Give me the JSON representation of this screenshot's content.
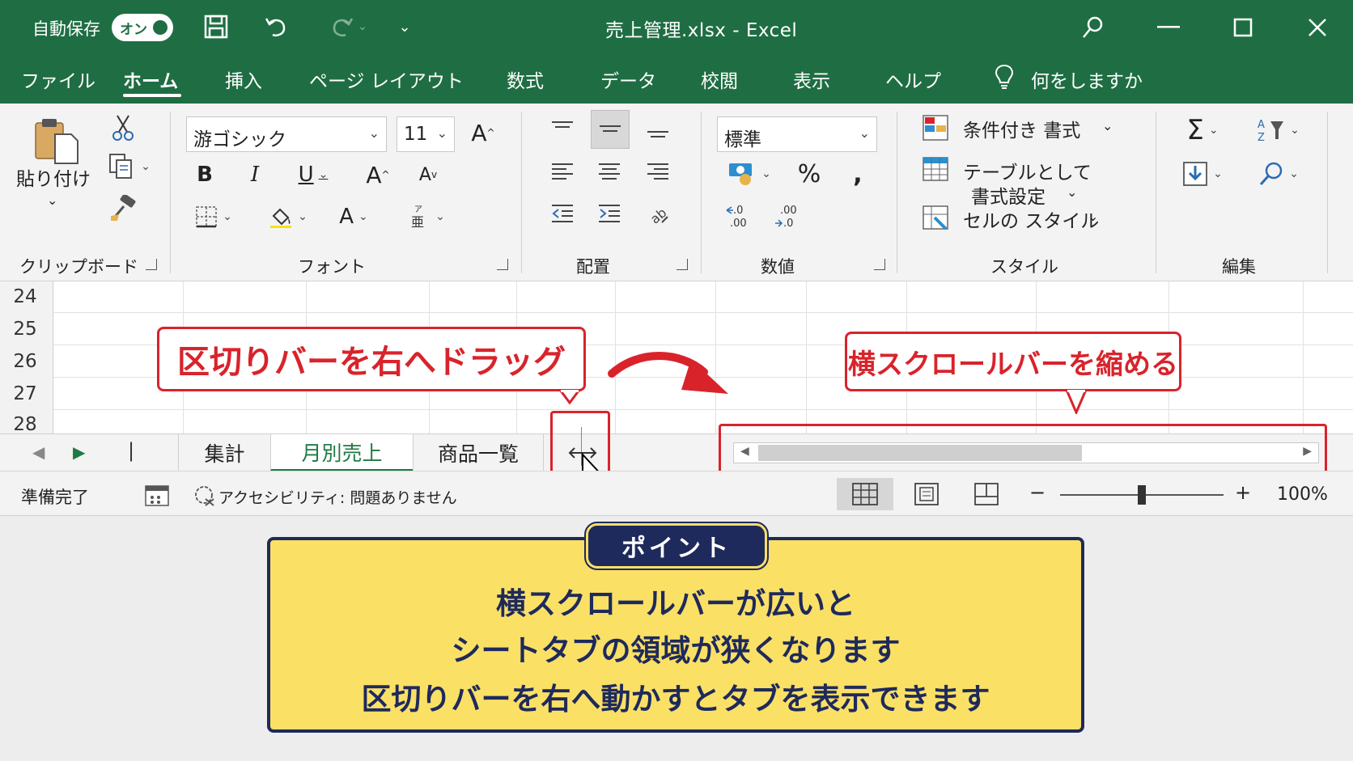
{
  "titlebar": {
    "autosave_label": "自動保存",
    "autosave_toggle": "オン",
    "title": "売上管理.xlsx  -  Excel"
  },
  "menu": {
    "items": [
      "ファイル",
      "ホーム",
      "挿入",
      "ページ レイアウト",
      "数式",
      "データ",
      "校閲",
      "表示",
      "ヘルプ"
    ],
    "active": "ホーム",
    "tell_me": "何をしますか"
  },
  "ribbon": {
    "clipboard": {
      "paste_label": "貼り付け",
      "group_label": "クリップボード"
    },
    "font": {
      "font_name": "游ゴシック",
      "font_size": "11",
      "group_label": "フォント"
    },
    "alignment": {
      "group_label": "配置"
    },
    "number": {
      "format": "標準",
      "group_label": "数値"
    },
    "styles": {
      "conditional": "条件付き 書式",
      "table_line1": "テーブルとして",
      "table_line2": "書式設定",
      "cell_styles": "セルの スタイル",
      "group_label": "スタイル"
    },
    "editing": {
      "group_label": "編集"
    }
  },
  "grid": {
    "row_numbers": [
      "24",
      "25",
      "26",
      "27",
      "28"
    ]
  },
  "callouts": {
    "drag": "区切りバーを右へドラッグ",
    "shrink": "横スクロールバーを縮める"
  },
  "sheet_tabs": {
    "tabs": [
      "集計",
      "月別売上",
      "商品一覧"
    ],
    "active": "月別売上"
  },
  "status": {
    "ready": "準備完了",
    "accessibility": "アクセシビリティ: 問題ありません",
    "zoom": "100%",
    "zoom_minus": "−",
    "zoom_plus": "+",
    "zoom_level": 0.5
  },
  "point": {
    "badge": "ポイント",
    "lines": [
      "横スクロールバーが広いと",
      "シートタブの領域が狭くなります",
      "区切りバーを右へ動かすとタブを表示できます"
    ]
  },
  "colors": {
    "excel_green": "#1f6e43",
    "callout_red": "#d9232b",
    "point_yellow": "#fbe066",
    "point_navy": "#1e2a5c"
  }
}
